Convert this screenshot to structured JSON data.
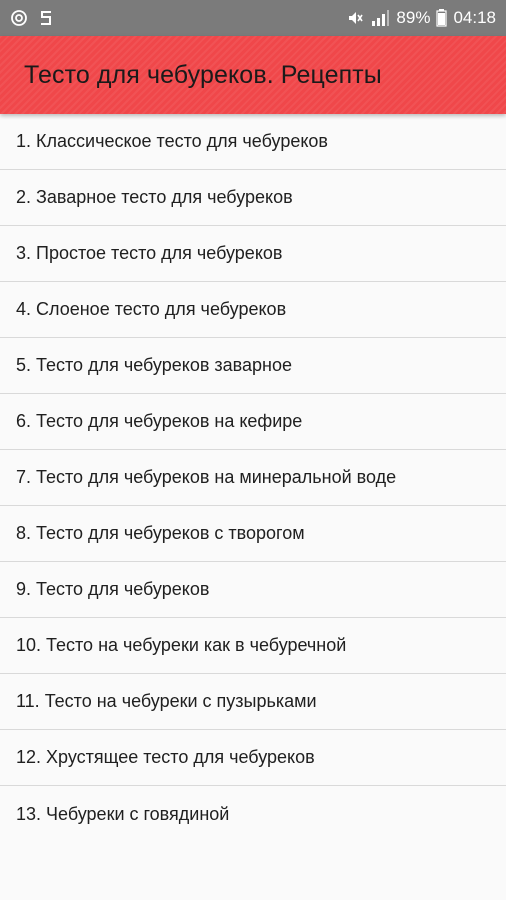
{
  "status_bar": {
    "left_icons": [
      "settings-notification-icon",
      "s-app-icon"
    ],
    "battery": "89%",
    "time": "04:18"
  },
  "app_bar": {
    "title": "Тесто для чебуреков. Рецепты",
    "color": "#f0474a"
  },
  "recipes": [
    {
      "label": "1. Классическое тесто для чебуреков"
    },
    {
      "label": "2. Заварное тесто для чебуреков"
    },
    {
      "label": "3. Простое тесто для чебуреков"
    },
    {
      "label": "4. Слоеное тесто для чебуреков"
    },
    {
      "label": "5. Тесто для чебуреков заварное"
    },
    {
      "label": "6. Тесто для чебуреков на кефире"
    },
    {
      "label": "7. Тесто для чебуреков на минеральной воде"
    },
    {
      "label": "8. Тесто для чебуреков с творогом"
    },
    {
      "label": "9. Тесто для чебуреков"
    },
    {
      "label": "10. Тесто на чебуреки как в чебуречной"
    },
    {
      "label": "11. Тесто на чебуреки с пузырьками"
    },
    {
      "label": "12. Хрустящее тесто для чебуреков"
    },
    {
      "label": "13. Чебуреки с говядиной"
    }
  ]
}
